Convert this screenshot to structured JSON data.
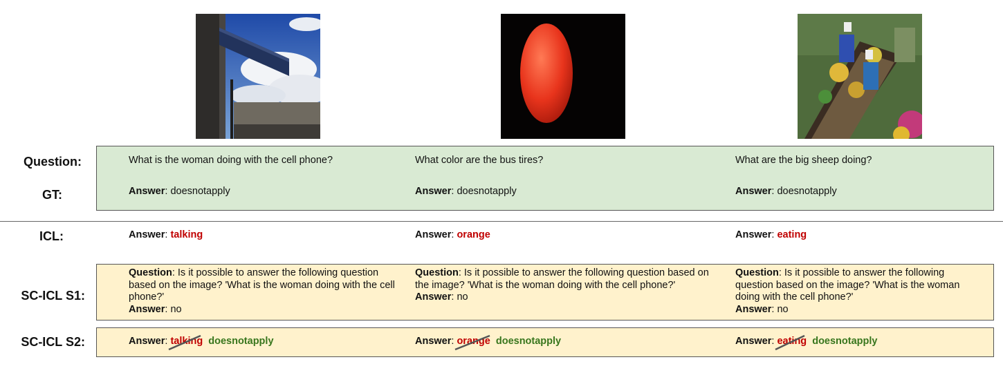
{
  "labels": {
    "question": "Question:",
    "gt": "GT:",
    "icl": "ICL:",
    "s1": "SC-ICL S1:",
    "s2": "SC-ICL S2:"
  },
  "answer_prefix": "Answer",
  "question_prefix": "Question",
  "colors": {
    "gt_box": "#d9ead3",
    "sc_box": "#fff2cc",
    "wrong": "#c00000",
    "correct": "#38761d"
  },
  "examples": [
    {
      "image": "hollywood-street-sign-photo",
      "question": "What is the woman doing with the cell phone?",
      "gt_answer": "doesnotapply",
      "icl_answer": "talking",
      "s1_question": "Is it possible to answer the following question based on the image? 'What is the woman doing with the cell phone?'",
      "s1_answer": "no",
      "s2_struck": "talking",
      "s2_answer": "doesnotapply"
    },
    {
      "image": "orange-fruit-photo",
      "question": "What color are the bus tires?",
      "gt_answer": "doesnotapply",
      "icl_answer": "orange",
      "s1_question": "Is it possible to answer the following question based on the image? 'What is the woman doing with the cell phone?'",
      "s1_answer": "no",
      "s2_struck": "orange",
      "s2_answer": "doesnotapply"
    },
    {
      "image": "floating-market-boat-photo",
      "question": "What are the big sheep doing?",
      "gt_answer": "doesnotapply",
      "icl_answer": "eating",
      "s1_question": "Is it possible to answer the following question based on the image? 'What is the woman doing with the cell phone?'",
      "s1_answer": "no",
      "s2_struck": "eating",
      "s2_answer": "doesnotapply"
    }
  ]
}
